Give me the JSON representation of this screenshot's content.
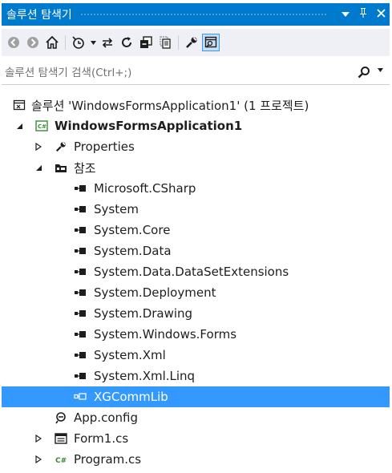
{
  "window": {
    "title": "솔루션 탐색기",
    "dropdown_glyph": "▼",
    "pin_glyph": "ꟸ",
    "close_glyph": "✕"
  },
  "toolbar": {
    "buttons": [
      {
        "name": "back-button",
        "icon": "back-icon"
      },
      {
        "name": "forward-button",
        "icon": "forward-icon"
      },
      {
        "name": "home-button",
        "icon": "home-icon"
      },
      {
        "name": "pending-changes-button",
        "icon": "history-icon"
      },
      {
        "name": "sync-button",
        "icon": "sync-icon"
      },
      {
        "name": "refresh-button",
        "icon": "refresh-icon"
      },
      {
        "name": "collapse-all-button",
        "icon": "collapse-all-icon"
      },
      {
        "name": "show-all-files-button",
        "icon": "show-all-files-icon"
      },
      {
        "name": "properties-button",
        "icon": "wrench-icon"
      },
      {
        "name": "preview-button",
        "icon": "preview-icon"
      }
    ]
  },
  "search": {
    "placeholder": "솔루션 탐색기 검색(Ctrl+;)",
    "value": ""
  },
  "tree": {
    "solution": "솔루션 'WindowsFormsApplication1' (1 프로젝트)",
    "project": "WindowsFormsApplication1",
    "properties": "Properties",
    "references": "참조",
    "reference_items": [
      "Microsoft.CSharp",
      "System",
      "System.Core",
      "System.Data",
      "System.Data.DataSetExtensions",
      "System.Deployment",
      "System.Drawing",
      "System.Windows.Forms",
      "System.Xml",
      "System.Xml.Linq",
      "XGCommLib"
    ],
    "selected": "XGCommLib",
    "app_config": "App.config",
    "form1": "Form1.cs",
    "program": "Program.cs"
  },
  "colors": {
    "accent": "#007acc",
    "selection": "#3399ff",
    "toolbar_bg": "#eef0f5"
  }
}
